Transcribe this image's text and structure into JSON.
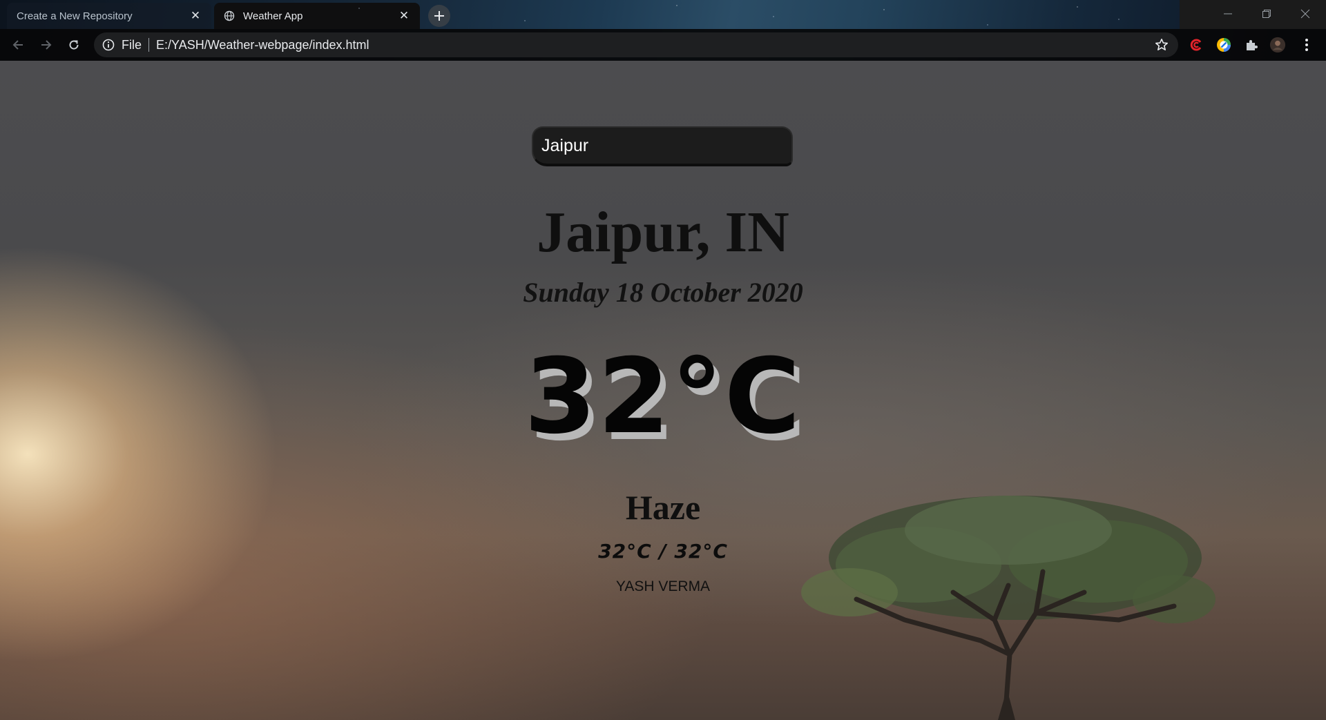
{
  "browser": {
    "tabs": [
      {
        "title": "Create a New Repository",
        "active": false
      },
      {
        "title": "Weather App",
        "active": true
      }
    ],
    "address": {
      "scheme_label": "File",
      "url": "E:/YASH/Weather-webpage/index.html"
    },
    "icons": [
      "back-icon",
      "forward-icon",
      "reload-icon",
      "info-icon",
      "star-icon",
      "extension-icon",
      "puzzle-icon",
      "avatar",
      "kebab-menu-icon",
      "minimize-icon",
      "restore-icon",
      "close-icon",
      "new-tab-icon"
    ]
  },
  "weather": {
    "search_value": "Jaipur",
    "location": "Jaipur, IN",
    "date": "Sunday 18 October 2020",
    "temperature": "32°C",
    "condition": "Haze",
    "hi_low": "32°C / 32°C",
    "author": "YASH VERMA"
  },
  "colors": {
    "search_bg": "#1c1c1c",
    "text_dark": "#0f0f0f",
    "temp_shadow": "#b8b8b8",
    "active_tab": "#0f0f10"
  }
}
